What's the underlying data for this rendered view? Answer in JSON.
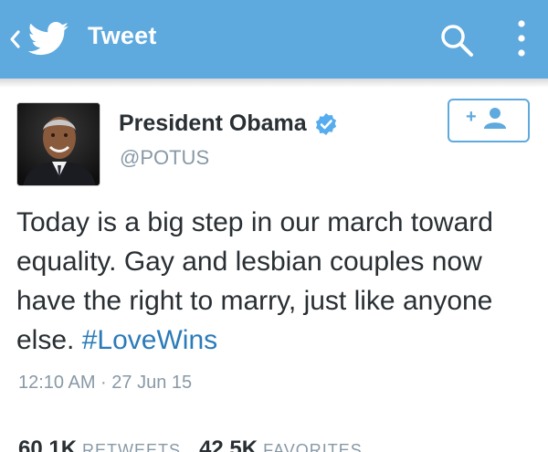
{
  "header": {
    "title": "Tweet",
    "back_icon": "chevron-left-icon",
    "logo_icon": "twitter-bird-icon",
    "search_icon": "search-icon",
    "menu_icon": "more-vertical-icon",
    "bar_color": "#5ea9dd"
  },
  "tweet": {
    "author_name": "President Obama",
    "handle": "@POTUS",
    "verified": true,
    "follow_icon": "add-user-icon",
    "text_before": "Today is a big step in our march toward equality. Gay and lesbian couples now have the right to marry, just like anyone else. ",
    "hashtag": "#LoveWins",
    "timestamp": "12:10 AM · 27 Jun 15",
    "hashtag_color": "#2b7bb9"
  },
  "stats": {
    "retweets_count": "60.1K",
    "retweets_label": "RETWEETS",
    "favorites_count": "42.5K",
    "favorites_label": "FAVORITES"
  }
}
